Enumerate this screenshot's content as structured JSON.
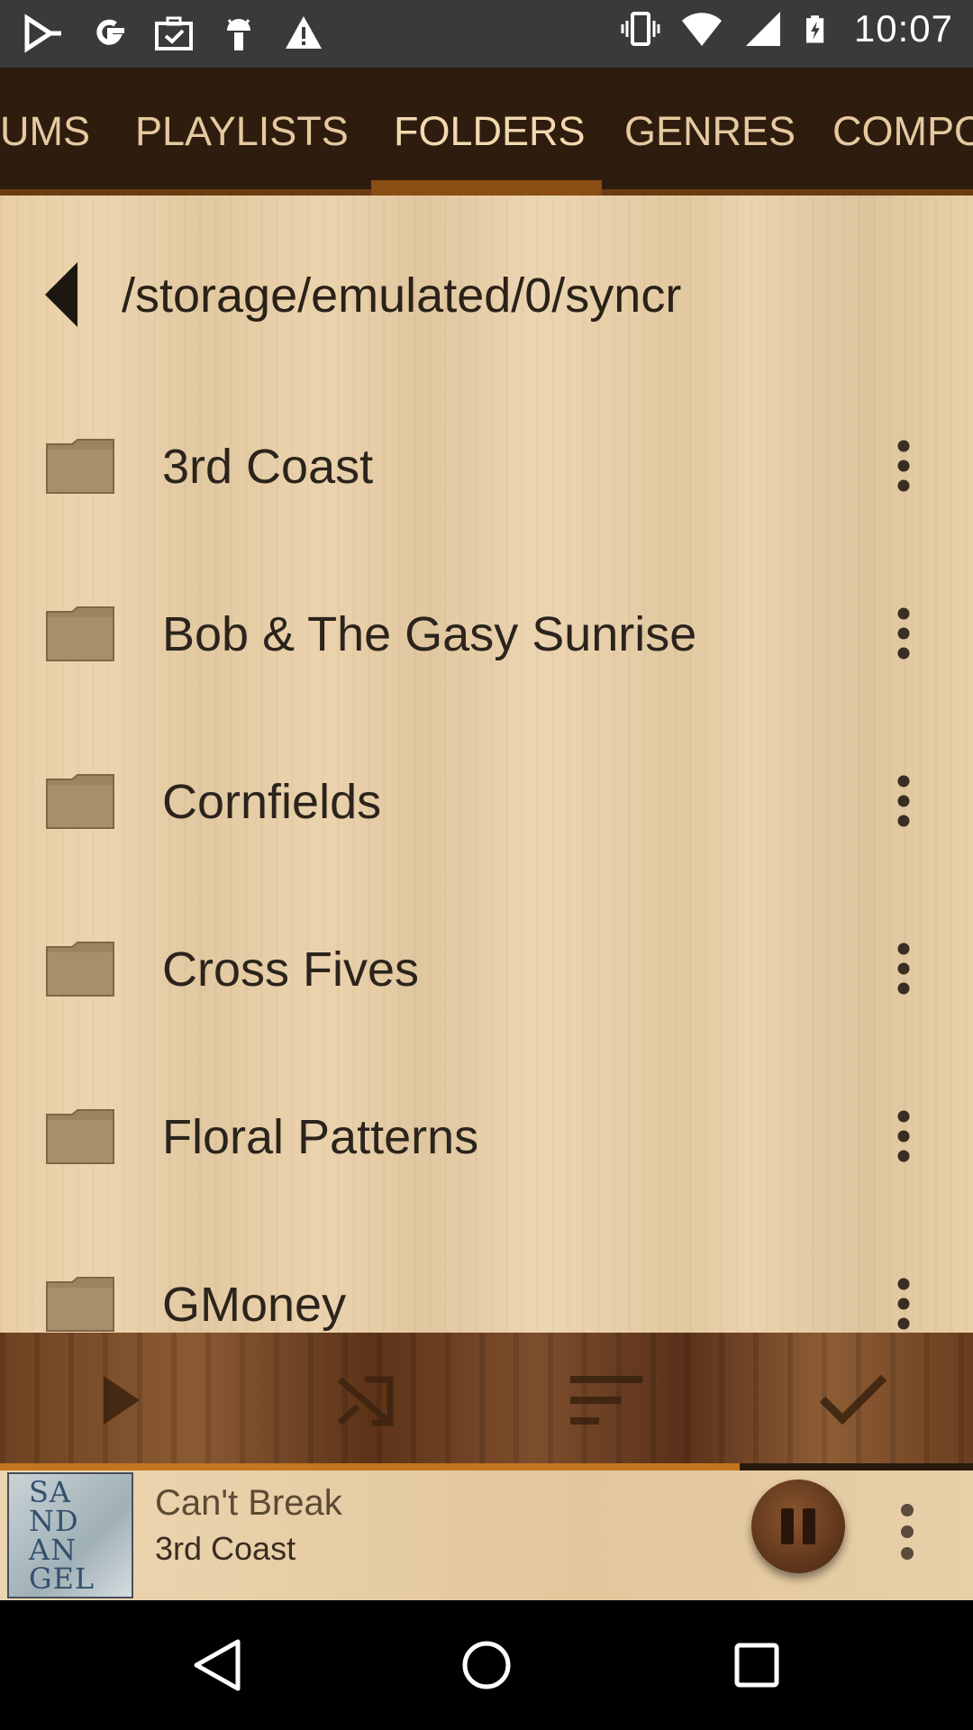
{
  "status_bar": {
    "time": "10:07",
    "left_icons": [
      "play-store-icon",
      "google-icon",
      "briefcase-check-icon",
      "android-icon",
      "warning-icon"
    ],
    "right_icons": [
      "vibrate-icon",
      "wifi-icon",
      "signal-icon",
      "battery-charging-icon"
    ]
  },
  "tabs": [
    {
      "label": "UMS",
      "active": false
    },
    {
      "label": "PLAYLISTS",
      "active": false
    },
    {
      "label": "FOLDERS",
      "active": true
    },
    {
      "label": "GENRES",
      "active": false
    },
    {
      "label": "COMPO",
      "active": false
    }
  ],
  "browser": {
    "path": "/storage/emulated/0/syncr",
    "folders": [
      "3rd Coast",
      "Bob & The Gasy Sunrise",
      "Cornfields",
      "Cross Fives",
      "Floral Patterns",
      "GMoney"
    ]
  },
  "action_bar": {
    "buttons": [
      "play-icon",
      "shuffle-icon",
      "sort-icon",
      "check-icon"
    ]
  },
  "now_playing": {
    "title": "Can't Break",
    "artist": "3rd Coast",
    "album_art_text": [
      "SA",
      "ND",
      "AN",
      "GEL"
    ],
    "progress": 0.76,
    "state": "playing"
  },
  "colors": {
    "tab_bar": "#2e1d0f",
    "tab_text": "#e6c9a0",
    "accent": "#8a4d13",
    "wood_light": "#e9cfa6",
    "progress": "#c4751f"
  }
}
